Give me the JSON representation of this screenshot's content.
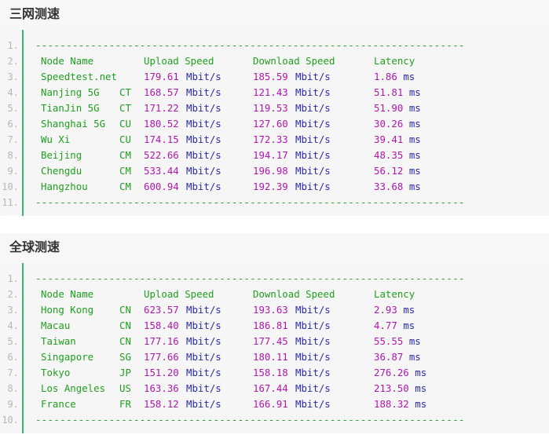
{
  "sections": [
    {
      "title": "三网测速",
      "header": {
        "node": "Node Name",
        "upload": "Upload Speed",
        "download": "Download Speed",
        "latency": "Latency"
      },
      "rows": [
        {
          "node": "Speedtest.net",
          "isp": "",
          "up": "179.61",
          "down": "185.59",
          "lat": "1.86"
        },
        {
          "node": "Nanjing 5G",
          "isp": "CT",
          "up": "168.57",
          "down": "121.43",
          "lat": "51.81"
        },
        {
          "node": "TianJin 5G",
          "isp": "CT",
          "up": "171.22",
          "down": "119.53",
          "lat": "51.90"
        },
        {
          "node": "Shanghai 5G",
          "isp": "CU",
          "up": "180.52",
          "down": "127.60",
          "lat": "30.26"
        },
        {
          "node": "Wu Xi",
          "isp": "CU",
          "up": "174.15",
          "down": "172.33",
          "lat": "39.41"
        },
        {
          "node": "Beijing",
          "isp": "CM",
          "up": "522.66",
          "down": "194.17",
          "lat": "48.35"
        },
        {
          "node": "Chengdu",
          "isp": "CM",
          "up": "533.44",
          "down": "196.98",
          "lat": "56.12"
        },
        {
          "node": "Hangzhou",
          "isp": "CM",
          "up": "600.94",
          "down": "192.39",
          "lat": "33.68"
        }
      ]
    },
    {
      "title": "全球测速",
      "header": {
        "node": "Node Name",
        "upload": "Upload Speed",
        "download": "Download Speed",
        "latency": "Latency"
      },
      "rows": [
        {
          "node": "Hong Kong",
          "isp": "CN",
          "up": "623.57",
          "down": "193.63",
          "lat": "2.93"
        },
        {
          "node": "Macau",
          "isp": "CN",
          "up": "158.40",
          "down": "186.81",
          "lat": "4.77"
        },
        {
          "node": "Taiwan",
          "isp": "CN",
          "up": "177.16",
          "down": "177.45",
          "lat": "55.55"
        },
        {
          "node": "Singapore",
          "isp": "SG",
          "up": "177.66",
          "down": "180.11",
          "lat": "36.87"
        },
        {
          "node": "Tokyo",
          "isp": "JP",
          "up": "151.20",
          "down": "158.18",
          "lat": "276.26"
        },
        {
          "node": "Los Angeles",
          "isp": "US",
          "up": "163.36",
          "down": "167.44",
          "lat": "213.50"
        },
        {
          "node": "France",
          "isp": "FR",
          "up": "158.12",
          "down": "166.91",
          "lat": "188.32"
        }
      ]
    }
  ],
  "units": {
    "speed": "Mbit/s",
    "latency": "ms"
  },
  "rule_line": "----------------------------------------------------------------------",
  "colors": {
    "accent_bar": "#3cb371",
    "text_green": "#1e9e1e",
    "text_magenta": "#b017b0",
    "text_navy": "#2a2aa8"
  }
}
